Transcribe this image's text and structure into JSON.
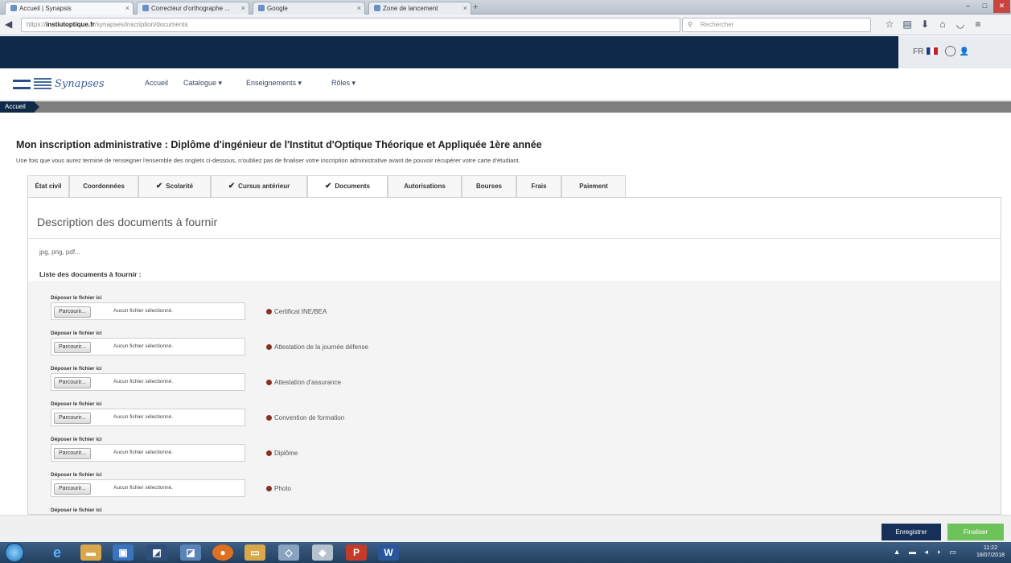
{
  "browser": {
    "tabs": [
      {
        "label": "Accueil | Synapsis"
      },
      {
        "label": "Correcteur d'orthographe ..."
      },
      {
        "label": "Google"
      },
      {
        "label": "Zone de lancement"
      }
    ],
    "url_prefix": "https://",
    "url_host": "instiutoptique.fr",
    "url_path": "/synapses/inscription/documents",
    "search_placeholder": "Rechercher",
    "new_tab": "+",
    "min": "–",
    "max": "□",
    "close": "✕"
  },
  "topbar": {
    "lang": "FR"
  },
  "site": {
    "logo_text": "Synapses",
    "menu": [
      "Accueil",
      "Catalogue ▾",
      "Enseignements ▾",
      "Rôles ▾"
    ]
  },
  "breadcrumb": {
    "label": "Accueil"
  },
  "page": {
    "title": "Mon inscription administrative : Diplôme d'ingénieur de l'Institut d'Optique Théorique et Appliquée 1ère année",
    "intro": "Une fois que vous aurez terminé de renseigner l'ensemble des onglets ci-dessous, n'oubliez pas de finaliser votre inscription administrative avant de pouvoir récupérer votre carte d'étudiant."
  },
  "tabs": [
    {
      "label": "État civil",
      "checked": false
    },
    {
      "label": "Coordonnées",
      "checked": false
    },
    {
      "label": "Scolarité",
      "checked": true
    },
    {
      "label": "Cursus antérieur",
      "checked": true
    },
    {
      "label": "Documents",
      "checked": true,
      "active": true
    },
    {
      "label": "Autorisations",
      "checked": false
    },
    {
      "label": "Bourses",
      "checked": false
    },
    {
      "label": "Frais",
      "checked": false
    },
    {
      "label": "Paiement",
      "checked": false
    }
  ],
  "documents": {
    "title": "Description des documents à fournir",
    "formats": "jpg, png, pdf...",
    "list_title": "Liste des documents à fournir :",
    "drop_label": "Déposer le fichier ici",
    "browse_label": "Parcourir...",
    "no_file_label": "Aucun fichier sélectionné.",
    "items": [
      "Certificat INE/BEA",
      "Attestation de la journée défense",
      "Attestation d'assurance",
      "Convention de formation",
      "Diplôme",
      "Photo"
    ],
    "status_color": "#8a2f23"
  },
  "actions": {
    "save": "Enregistrer",
    "finalize": "Finaliser"
  },
  "taskbar": {
    "time": "11:22",
    "date": "18/07/2018"
  },
  "colors": {
    "navy": "#0f2a48",
    "accent_green": "#6ec25a"
  }
}
